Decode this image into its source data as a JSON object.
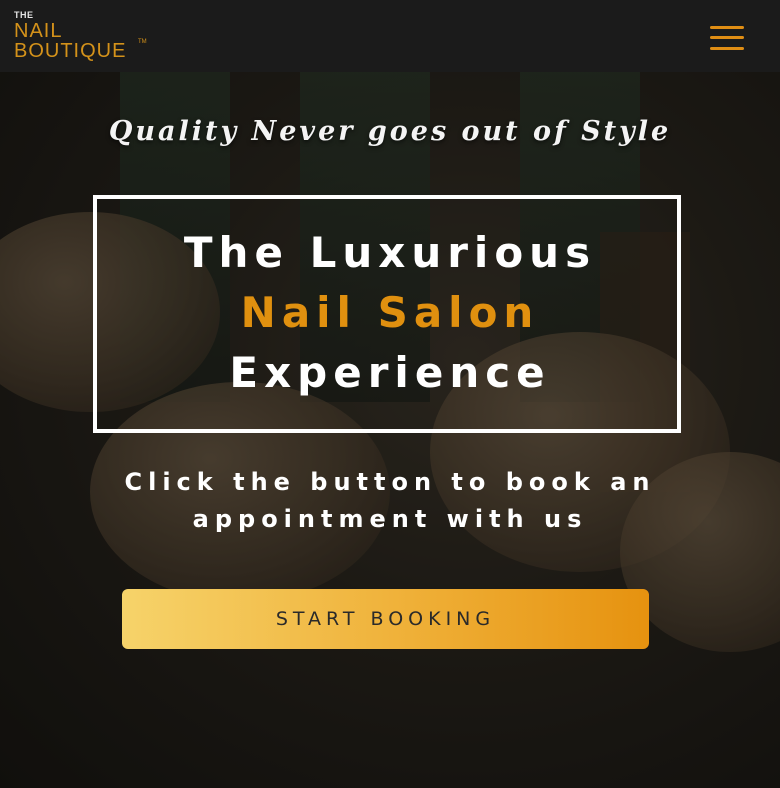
{
  "header": {
    "logo": {
      "the": "THE",
      "nail": "NAIL",
      "boutique": "BOUTIQUE",
      "tm": "TM"
    },
    "menu_icon": "hamburger-menu-icon",
    "accent_color": "#e08e14"
  },
  "hero": {
    "tagline": "Quality Never goes out of Style",
    "headline": {
      "line1": "The Luxurious",
      "line2": "Nail Salon",
      "line3": "Experience"
    },
    "subtext": {
      "line1": "Click the button to book an",
      "line2": "appointment with us"
    },
    "cta_label": "START BOOKING",
    "colors": {
      "headline_accent": "#e0900f",
      "text": "#ffffff",
      "cta_start": "#f6d36a",
      "cta_end": "#e6920f"
    }
  }
}
